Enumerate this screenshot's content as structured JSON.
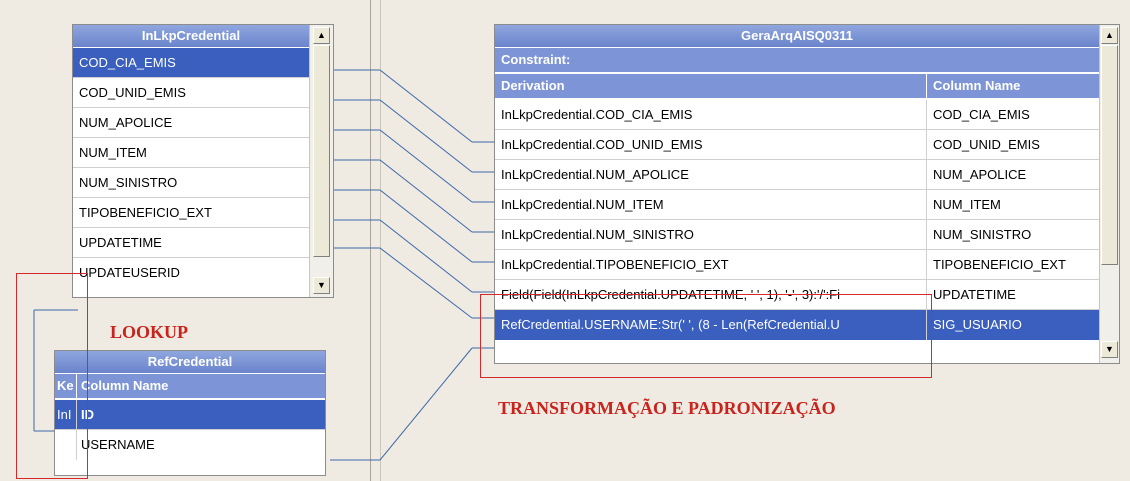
{
  "lookup_table": {
    "title": "InLkpCredential",
    "rows": [
      "COD_CIA_EMIS",
      "COD_UNID_EMIS",
      "NUM_APOLICE",
      "NUM_ITEM",
      "NUM_SINISTRO",
      "TIPOBENEFICIO_EXT",
      "UPDATETIME",
      "UPDATEUSERID"
    ],
    "selected_index": 0
  },
  "ref_table": {
    "title": "RefCredential",
    "col_key": "Ke",
    "col_name": "Column Name",
    "rows": [
      {
        "key": "InI",
        "name": "ID"
      },
      {
        "key": "",
        "name": "USERNAME"
      }
    ],
    "selected_index": 0
  },
  "target_table": {
    "title": "GeraArqAISQ0311",
    "constraint_label": "Constraint:",
    "col_derivation": "Derivation",
    "col_name": "Column Name",
    "rows": [
      {
        "derivation": "InLkpCredential.COD_CIA_EMIS",
        "column": "COD_CIA_EMIS"
      },
      {
        "derivation": "InLkpCredential.COD_UNID_EMIS",
        "column": "COD_UNID_EMIS"
      },
      {
        "derivation": "InLkpCredential.NUM_APOLICE",
        "column": "NUM_APOLICE"
      },
      {
        "derivation": "InLkpCredential.NUM_ITEM",
        "column": "NUM_ITEM"
      },
      {
        "derivation": "InLkpCredential.NUM_SINISTRO",
        "column": "NUM_SINISTRO"
      },
      {
        "derivation": "InLkpCredential.TIPOBENEFICIO_EXT",
        "column": "TIPOBENEFICIO_EXT"
      },
      {
        "derivation": "Field(Field(InLkpCredential.UPDATETIME, ' ', 1), '-', 3):'/':Fi",
        "column": "UPDATETIME"
      },
      {
        "derivation": "RefCredential.USERNAME:Str(' ', (8 - Len(RefCredential.U",
        "column": "SIG_USUARIO"
      }
    ],
    "selected_index": 7
  },
  "annotations": {
    "lookup": "LOOKUP",
    "transform": "TRANSFORMAÇÃO E PADRONIZAÇÃO"
  },
  "colors": {
    "header": "#7d95d6",
    "selection": "#3a5fbe",
    "annotation": "#c8231c",
    "link_line": "#3d68a8"
  }
}
